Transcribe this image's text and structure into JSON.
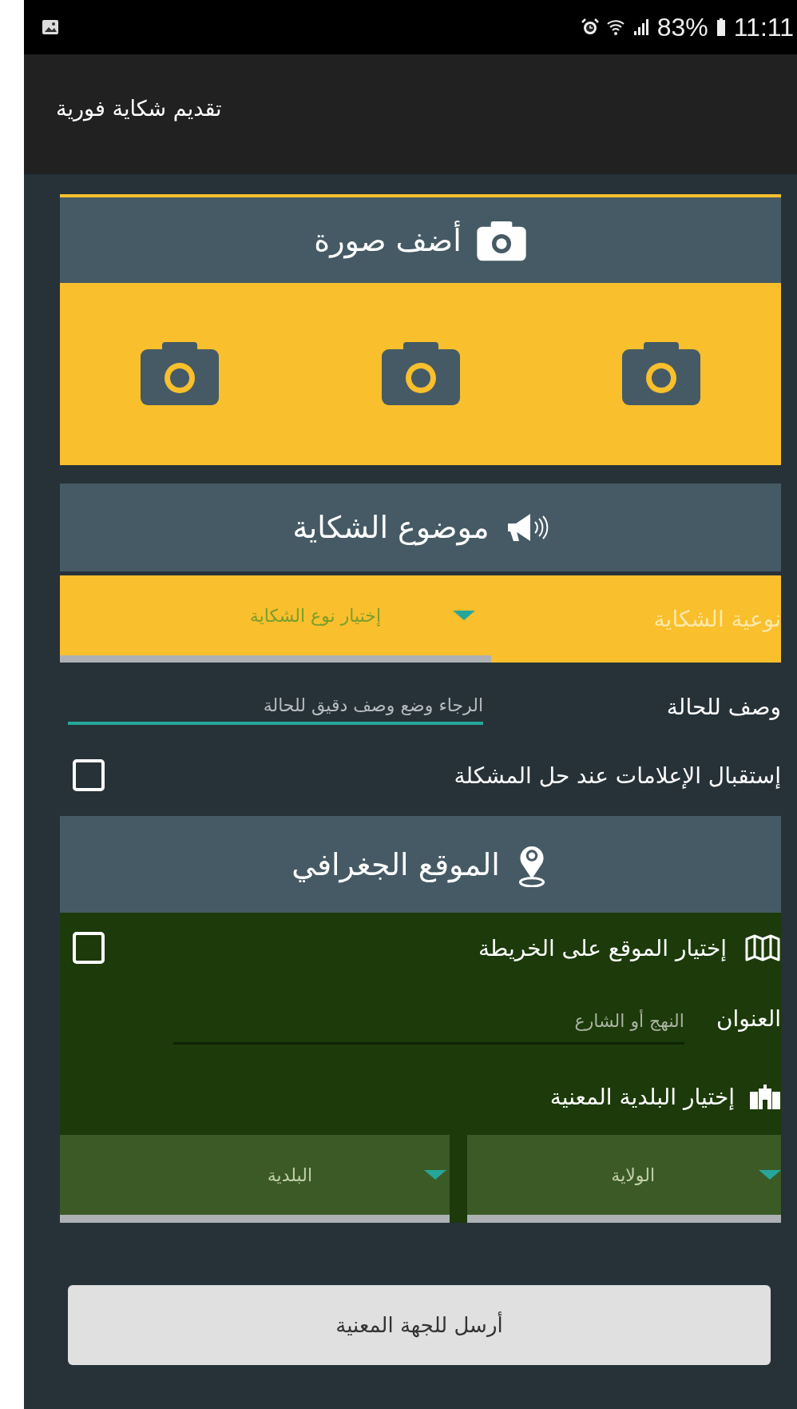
{
  "status_bar": {
    "battery": "83%",
    "time": "11:11"
  },
  "app_bar": {
    "title": "تقديم شكاية فورية"
  },
  "photo_section": {
    "title": "أضف صورة"
  },
  "complaint_section": {
    "title": "موضوع الشكاية",
    "type_field": {
      "label": "نوعية الشكاية",
      "placeholder": "إختيار نوع الشكاية"
    },
    "description": {
      "label": "وصف للحالة",
      "placeholder": "الرجاء وضع وصف دقيق للحالة"
    },
    "notify": {
      "label": "إستقبال الإعلامات عند حل المشكلة",
      "checked": false
    }
  },
  "location_section": {
    "title": "الموقع الجغرافي",
    "map_option": {
      "label": "إختيار الموقع على الخريطة",
      "checked": false
    },
    "address": {
      "label": "العنوان",
      "placeholder": "النهج أو الشارع"
    },
    "municipality": {
      "label": "إختيار البلدية المعنية",
      "selects": [
        {
          "placeholder": "الولاية"
        },
        {
          "placeholder": "البلدية"
        }
      ]
    }
  },
  "submit_button": {
    "label": "أرسل للجهة المعنية"
  }
}
